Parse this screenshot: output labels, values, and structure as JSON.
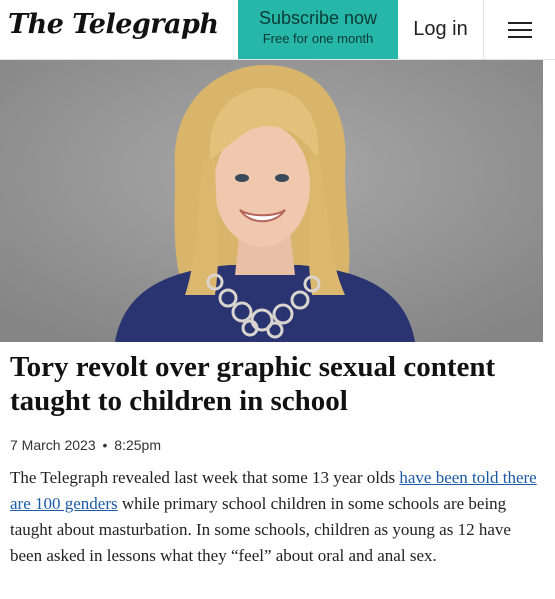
{
  "header": {
    "logo": "The Telegraph",
    "subscribe_label": "Subscribe now",
    "subscribe_sub": "Free for one month",
    "login_label": "Log in",
    "menu_icon": "hamburger-icon"
  },
  "colors": {
    "subscribe_bg": "#26b7a8",
    "link": "#1b5aa6"
  },
  "article": {
    "headline": "Tory revolt over graphic sexual content taught to children in school",
    "date": "7 March 2023",
    "separator": "•",
    "time": "8:25pm",
    "body_intro": "The Telegraph revealed last week that some 13 year olds ",
    "body_link": "have been told there are 100 genders",
    "body_rest": " while primary school children in some schools are being taught about masturbation. In some schools, children as young as 12 have been asked in lessons what they “feel” about oral and anal sex."
  }
}
